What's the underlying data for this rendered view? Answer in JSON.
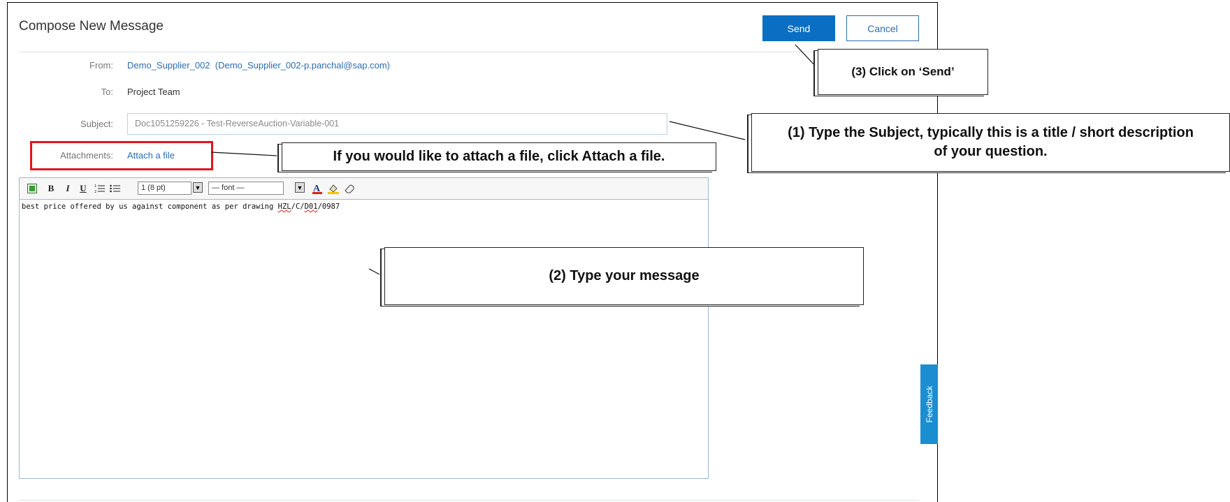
{
  "page": {
    "title": "Compose New Message"
  },
  "buttons": {
    "send": "Send",
    "cancel": "Cancel"
  },
  "form": {
    "from_label": "From:",
    "from_name": "Demo_Supplier_002",
    "from_email": "(Demo_Supplier_002-p.panchal@sap.com)",
    "to_label": "To:",
    "to_value": "Project Team",
    "subject_label": "Subject:",
    "subject_value": "Doc1051259226 - Test-ReverseAuction-Variable-001",
    "attachments_label": "Attachments:",
    "attach_link": "Attach a file"
  },
  "editor": {
    "font_size_value": "1 (8 pt)",
    "font_value": "— font —",
    "text_before": "best price offered by us against component as per drawing ",
    "text_hzl": "HZL",
    "text_mid": "/C/",
    "text_d01": "D01",
    "text_after": "/0987"
  },
  "feedback": "Feedback",
  "callouts": {
    "send": "(3) Click on ‘Send’",
    "subject": "(1) Type the Subject, typically this is a title / short description of your question.",
    "attach": "If you would like to attach a file, click Attach a file.",
    "message": "(2) Type your message"
  },
  "colors": {
    "accent": "#0a6fc2",
    "link": "#2a6db3",
    "highlight": "#e4141b",
    "feedback": "#1a8ed1"
  }
}
